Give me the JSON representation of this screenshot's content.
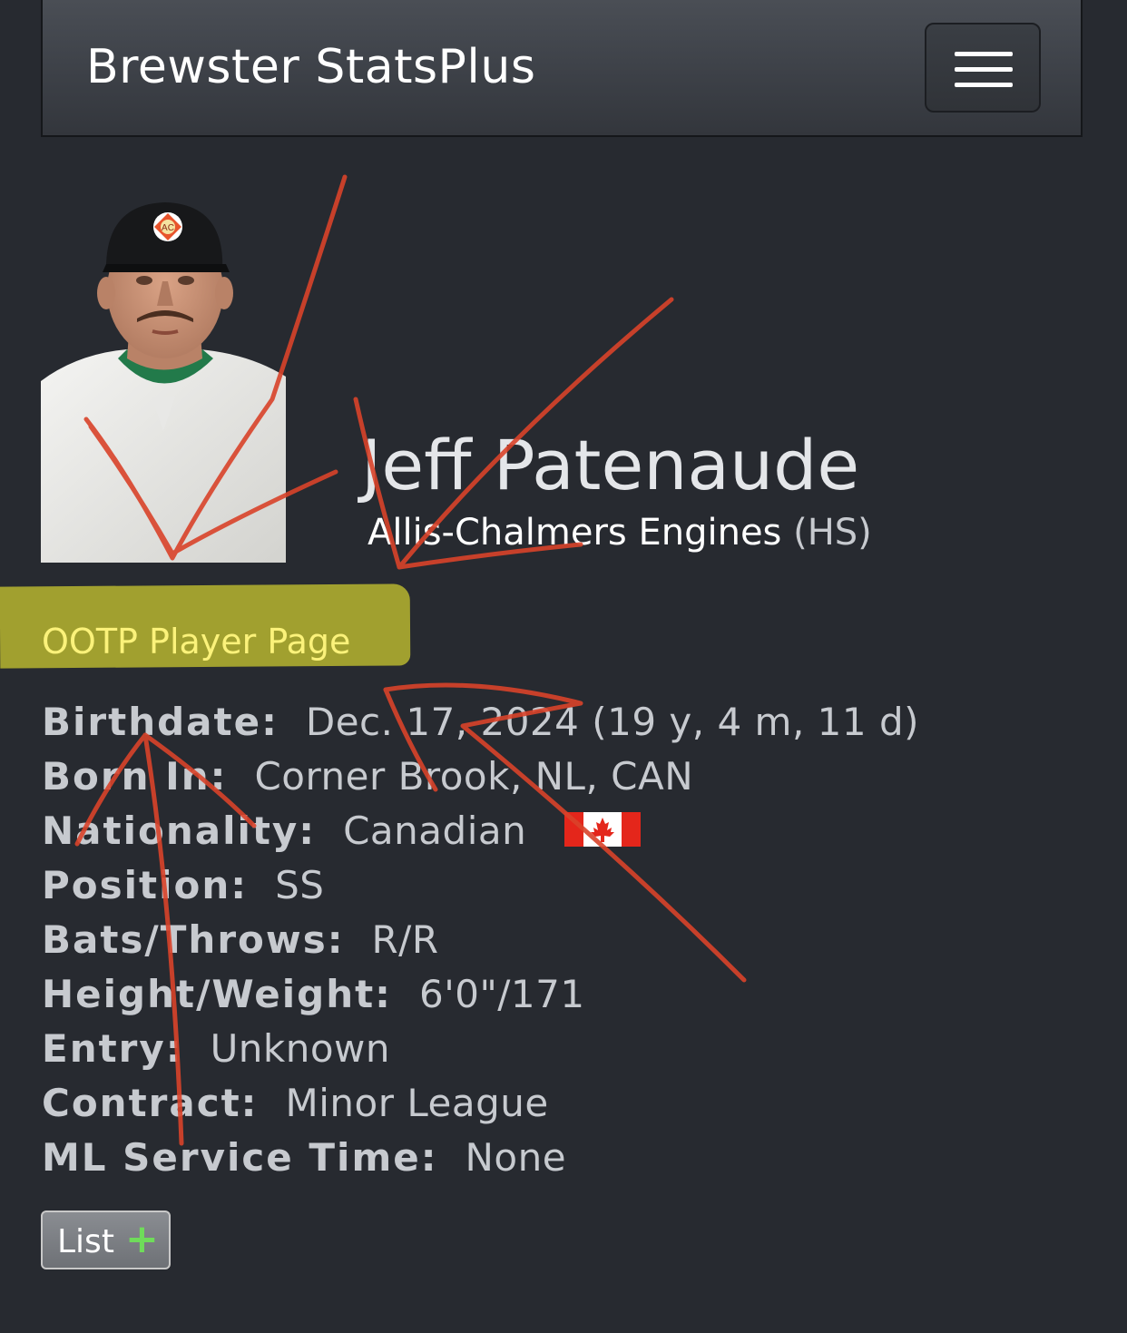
{
  "navbar": {
    "brand": "Brewster StatsPlus",
    "menu_icon": "hamburger-menu-icon"
  },
  "player": {
    "name": "Jeff Patenaude",
    "team": "Allis-Chalmers Engines",
    "level": "(HS)",
    "photo_alt": "player-photo",
    "cap_logo": "AC"
  },
  "links": {
    "ootp_player_page": "OOTP Player Page"
  },
  "info": {
    "birthdate": {
      "label": "Birthdate:",
      "value": "Dec. 17, 2024 (19 y, 4 m, 11 d)"
    },
    "born_in": {
      "label": "Born In:",
      "value": "Corner Brook, NL, CAN"
    },
    "nationality": {
      "label": "Nationality:",
      "value": "Canadian",
      "flag_icon": "canada-flag-icon"
    },
    "position": {
      "label": "Position:",
      "value": "SS"
    },
    "bats_throws": {
      "label": "Bats/Throws:",
      "value": "R/R"
    },
    "height_weight": {
      "label": "Height/Weight:",
      "value": "6'0\"/171"
    },
    "entry": {
      "label": "Entry:",
      "value": "Unknown"
    },
    "contract": {
      "label": "Contract:",
      "value": "Minor League"
    },
    "ml_service_time": {
      "label": "ML Service Time:",
      "value": "None"
    }
  },
  "buttons": {
    "list_label": "List",
    "list_plus": "+"
  },
  "colors": {
    "background": "#272a30",
    "highlight": "#a8a62f",
    "link": "#fbf27a",
    "annotation": "#d9432a",
    "plus": "#6fdc5a"
  }
}
